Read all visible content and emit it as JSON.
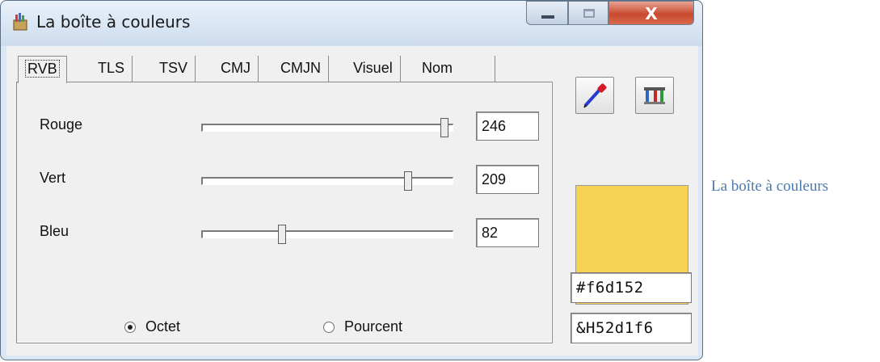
{
  "window": {
    "title": "La boîte à couleurs",
    "close_glyph": "X"
  },
  "tabs": [
    {
      "label": "RVB",
      "selected": true
    },
    {
      "label": "TLS",
      "selected": false
    },
    {
      "label": "TSV",
      "selected": false
    },
    {
      "label": "CMJ",
      "selected": false
    },
    {
      "label": "CMJN",
      "selected": false
    },
    {
      "label": "Visuel",
      "selected": false
    },
    {
      "label": "Nom",
      "selected": false
    }
  ],
  "channels": [
    {
      "label": "Rouge",
      "value": "246",
      "level": 0.965
    },
    {
      "label": "Vert",
      "value": "209",
      "level": 0.82
    },
    {
      "label": "Bleu",
      "value": "82",
      "level": 0.32
    }
  ],
  "mode": {
    "options": [
      {
        "label": "Octet",
        "checked": true
      },
      {
        "label": "Pourcent",
        "checked": false
      }
    ]
  },
  "tools": {
    "eyedropper_icon": "eyedropper-icon",
    "tools_icon": "tools-icon"
  },
  "color": {
    "swatch": "#f6d152",
    "hex": "#f6d152",
    "vb": "&H52d1f6"
  },
  "caption": "La boîte à couleurs",
  "colors": {
    "titlebar": "#dbe7f4",
    "close_button": "#c84a2f",
    "caption_link": "#4a7aad"
  }
}
